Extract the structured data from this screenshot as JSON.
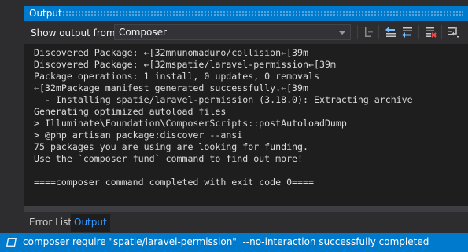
{
  "window": {
    "title": "Output"
  },
  "toolbar": {
    "show_output_label": "Show output from:",
    "source_selected": "Composer",
    "buttons": [
      {
        "name": "find-message-icon"
      },
      {
        "name": "previous-message-icon"
      },
      {
        "name": "next-message-icon"
      },
      {
        "name": "clear-all-icon"
      },
      {
        "name": "toggle-word-wrap-icon"
      }
    ]
  },
  "output": {
    "lines": [
      "Discovered Package: ←[32mnunomaduro/collision←[39m",
      "Discovered Package: ←[32mspatie/laravel-permission←[39m",
      "Package operations: 1 install, 0 updates, 0 removals",
      "←[32mPackage manifest generated successfully.←[39m",
      "  - Installing spatie/laravel-permission (3.18.0): Extracting archive",
      "Generating optimized autoload files",
      "> Illuminate\\Foundation\\ComposerScripts::postAutoloadDump",
      "> @php artisan package:discover --ansi",
      "75 packages you are using are looking for funding.",
      "Use the `composer fund` command to find out more!",
      "",
      "====composer command completed with exit code 0===="
    ]
  },
  "tabs": [
    {
      "label": "Error List",
      "active": false
    },
    {
      "label": "Output",
      "active": true
    }
  ],
  "statusbar": {
    "icon": "output-window-icon",
    "text": "composer require \"spatie/laravel-permission\"  --no-interaction successfully completed"
  },
  "colors": {
    "accent": "#007acc",
    "output_bg": "#1e1e1e",
    "panel_bg": "#2d2d30",
    "active_tab_text": "#3399ff"
  }
}
